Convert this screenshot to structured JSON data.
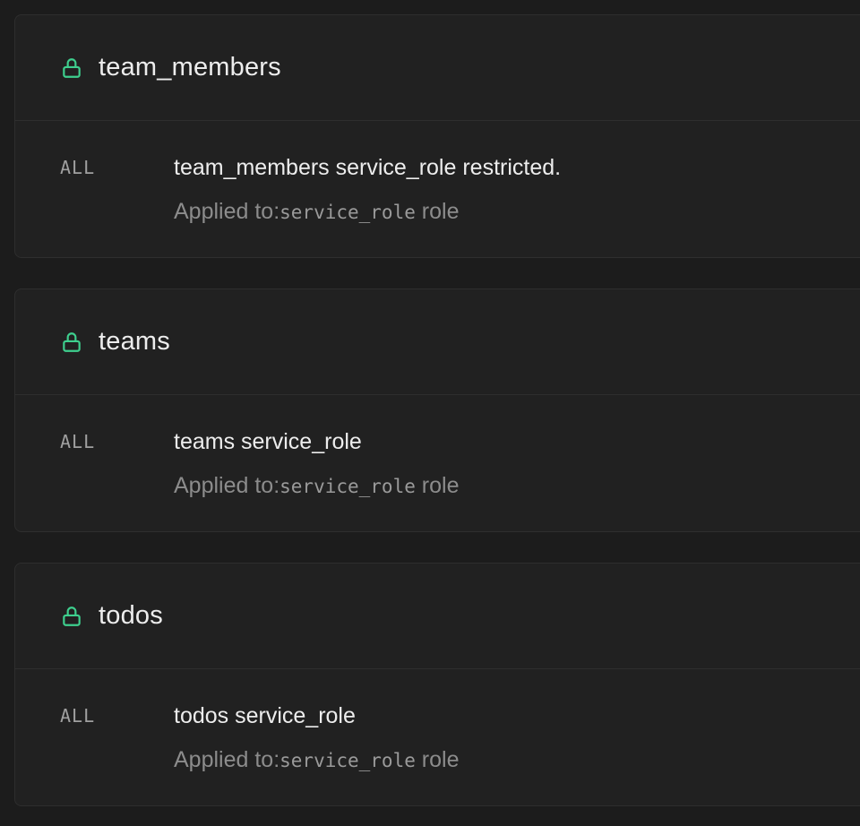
{
  "colors": {
    "background": "#1c1c1c",
    "card": "#212121",
    "border": "#2e2e2e",
    "lock_icon": "#3ecf8e",
    "text_primary": "#ededed",
    "text_muted": "#8c8c8c"
  },
  "tables": [
    {
      "name": "team_members",
      "icon": "lock-icon",
      "policies": [
        {
          "command": "ALL",
          "name": "team_members service_role restricted.",
          "applied_prefix": "Applied to:",
          "role": "service_role",
          "role_suffix": " role"
        }
      ]
    },
    {
      "name": "teams",
      "icon": "lock-icon",
      "policies": [
        {
          "command": "ALL",
          "name": "teams service_role",
          "applied_prefix": "Applied to:",
          "role": "service_role",
          "role_suffix": " role"
        }
      ]
    },
    {
      "name": "todos",
      "icon": "lock-icon",
      "policies": [
        {
          "command": "ALL",
          "name": "todos service_role",
          "applied_prefix": "Applied to:",
          "role": "service_role",
          "role_suffix": " role"
        }
      ]
    }
  ]
}
